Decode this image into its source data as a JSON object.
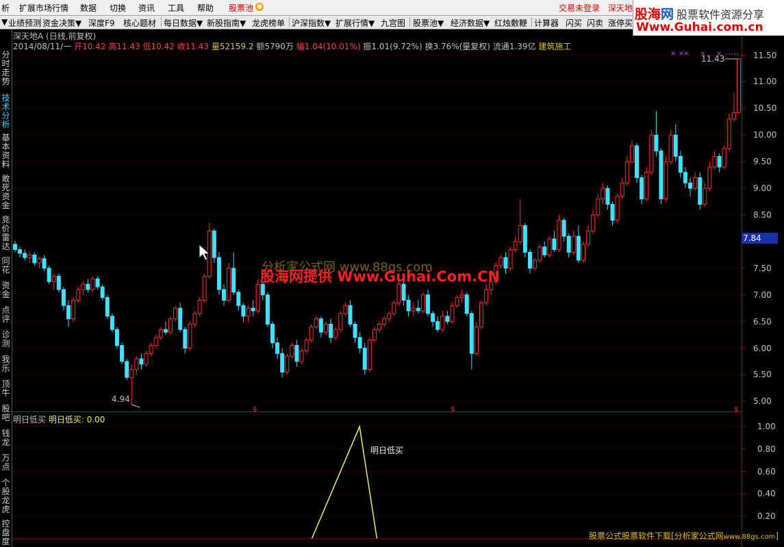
{
  "menu": {
    "items": [
      "析",
      "扩展市场行情",
      "数据",
      "切换",
      "资讯",
      "工具",
      "帮助"
    ],
    "stock_pool": "股票池",
    "login_status": "交易未登录",
    "market": "深天地"
  },
  "logo": {
    "brand_a": "股海",
    "brand_b": "网",
    "slogan": "股票软件资源分享",
    "url": "Www.Guhai.com.cn"
  },
  "toolbar": {
    "items": [
      "业绩预测",
      "资金决策▼",
      "深度F9",
      "核心题材",
      "每日数据▼",
      "新股指南▼",
      "龙虎榜单",
      "沪深指数▼",
      "扩展行情▼",
      "九宫图",
      "股票池▼",
      "经济数据▼",
      "红烛敷鞭",
      "计算器",
      "闪买",
      "闪卖",
      "涨停买"
    ]
  },
  "sidebar": {
    "items": [
      "分时走势",
      "技术分析",
      "基本资料",
      "敢死资金",
      "竞价雷达",
      "同花",
      "资金",
      "点评",
      "诊测",
      "我乐",
      "顶牛",
      "股吧",
      "钱龙",
      "万点",
      "个股龙虎",
      "控盘度"
    ],
    "active": "技术分析"
  },
  "chart_header": {
    "stock": "深天地A",
    "period": "(日线,前复权)"
  },
  "quote": {
    "date": "2014/08/11/一",
    "open_label": "开",
    "open": "10.42",
    "high_label": "高",
    "high": "11.43",
    "low_label": "低",
    "low": "10.42",
    "close_label": "收",
    "close": "11.43",
    "vol_label": "量",
    "volume": "52159.2",
    "amount_label": "额",
    "amount": "5790万",
    "chg_label": "幅",
    "change": "1.04(10.01%)",
    "amp_label": "振",
    "amplitude": "1.01(9.72%)",
    "turn_label": "换",
    "turnover": "3.76%(量复权)",
    "float_label": "流通",
    "float_cap": "1.39亿",
    "industry": "建筑施工"
  },
  "price_axis": {
    "ticks": [
      "11.50",
      "11.00",
      "10.50",
      "10.00",
      "9.50",
      "9.00",
      "8.50",
      "7.84",
      "7.50",
      "7.00",
      "6.50",
      "6.00",
      "5.50",
      "5.00"
    ],
    "current": "7.84"
  },
  "annotations": {
    "high_mark": "11.43",
    "low_mark": "4.94",
    "signal_marker": "$"
  },
  "indicator": {
    "name": "明日低买",
    "value_label": "明日低买: 0.00",
    "signal_text": "明日低买",
    "ticks": [
      "1.00",
      "0.80",
      "0.60",
      "0.40",
      "0.20"
    ]
  },
  "watermarks": {
    "line1": "分析家公式网 www.88gs.com",
    "line2": "股海网提供 Www.Guhai.Com.CN"
  },
  "footer": {
    "text": "股票公式股票软件下载[分析家公式网",
    "site": "www.88gs.com"
  },
  "colors": {
    "up": "#ff3030",
    "down": "#40e0ff",
    "grid": "#800000",
    "signal": "#f0f060"
  },
  "chart_data": {
    "type": "candlestick",
    "ylim": [
      4.85,
      11.7
    ],
    "candles": [
      [
        7.95,
        8.02,
        7.8,
        7.85
      ],
      [
        7.85,
        7.9,
        7.7,
        7.78
      ],
      [
        7.78,
        7.85,
        7.65,
        7.7
      ],
      [
        7.7,
        7.82,
        7.6,
        7.75
      ],
      [
        7.75,
        7.8,
        7.55,
        7.6
      ],
      [
        7.6,
        7.72,
        7.5,
        7.68
      ],
      [
        7.68,
        7.75,
        7.45,
        7.5
      ],
      [
        7.5,
        7.55,
        7.2,
        7.25
      ],
      [
        7.25,
        7.4,
        7.1,
        7.35
      ],
      [
        7.35,
        7.4,
        7.05,
        7.1
      ],
      [
        7.1,
        7.15,
        6.7,
        6.8
      ],
      [
        6.8,
        6.9,
        6.4,
        6.55
      ],
      [
        6.55,
        6.95,
        6.5,
        6.9
      ],
      [
        6.9,
        7.15,
        6.85,
        7.1
      ],
      [
        7.1,
        7.25,
        7.0,
        7.2
      ],
      [
        7.2,
        7.3,
        7.05,
        7.1
      ],
      [
        7.1,
        7.35,
        7.05,
        7.3
      ],
      [
        7.3,
        7.35,
        7.1,
        7.15
      ],
      [
        7.15,
        7.2,
        6.9,
        6.95
      ],
      [
        6.95,
        7.0,
        6.55,
        6.6
      ],
      [
        6.6,
        6.65,
        6.3,
        6.35
      ],
      [
        6.35,
        6.4,
        6.0,
        6.05
      ],
      [
        6.05,
        6.1,
        5.7,
        5.75
      ],
      [
        5.75,
        5.8,
        5.4,
        5.45
      ],
      [
        5.45,
        5.7,
        4.94,
        5.6
      ],
      [
        5.6,
        5.85,
        5.5,
        5.8
      ],
      [
        5.8,
        5.9,
        5.6,
        5.7
      ],
      [
        5.7,
        5.95,
        5.65,
        5.9
      ],
      [
        5.9,
        6.1,
        5.85,
        6.05
      ],
      [
        6.05,
        6.25,
        6.0,
        6.2
      ],
      [
        6.2,
        6.4,
        6.15,
        6.35
      ],
      [
        6.35,
        6.5,
        6.25,
        6.3
      ],
      [
        6.3,
        6.6,
        6.25,
        6.55
      ],
      [
        6.55,
        6.8,
        6.5,
        6.75
      ],
      [
        6.75,
        6.85,
        6.3,
        6.35
      ],
      [
        6.35,
        6.4,
        5.9,
        6.0
      ],
      [
        6.0,
        6.5,
        5.95,
        6.45
      ],
      [
        6.45,
        6.7,
        6.4,
        6.65
      ],
      [
        6.65,
        6.95,
        6.6,
        6.9
      ],
      [
        6.9,
        7.4,
        6.85,
        7.35
      ],
      [
        7.35,
        8.35,
        7.3,
        8.2
      ],
      [
        8.2,
        8.25,
        7.6,
        7.7
      ],
      [
        7.7,
        7.8,
        7.0,
        7.1
      ],
      [
        7.1,
        7.2,
        6.8,
        6.9
      ],
      [
        6.9,
        7.6,
        6.85,
        7.5
      ],
      [
        7.5,
        7.8,
        7.0,
        7.05
      ],
      [
        7.05,
        7.1,
        6.7,
        6.8
      ],
      [
        6.8,
        6.85,
        6.5,
        6.6
      ],
      [
        6.6,
        6.8,
        6.5,
        6.75
      ],
      [
        6.75,
        6.9,
        6.6,
        6.7
      ],
      [
        6.7,
        7.3,
        6.65,
        7.2
      ],
      [
        7.2,
        7.25,
        6.9,
        7.0
      ],
      [
        7.0,
        7.05,
        6.4,
        6.45
      ],
      [
        6.45,
        6.5,
        6.0,
        6.1
      ],
      [
        6.1,
        6.2,
        5.8,
        5.9
      ],
      [
        5.9,
        6.0,
        5.45,
        5.55
      ],
      [
        5.55,
        5.9,
        5.5,
        5.85
      ],
      [
        5.85,
        6.1,
        5.8,
        6.05
      ],
      [
        6.05,
        6.15,
        5.65,
        5.75
      ],
      [
        5.75,
        6.0,
        5.7,
        5.95
      ],
      [
        5.95,
        6.2,
        5.9,
        6.15
      ],
      [
        6.15,
        6.45,
        6.1,
        6.4
      ],
      [
        6.4,
        6.6,
        6.35,
        6.55
      ],
      [
        6.55,
        6.6,
        6.2,
        6.3
      ],
      [
        6.3,
        6.5,
        6.25,
        6.45
      ],
      [
        6.45,
        6.55,
        6.1,
        6.2
      ],
      [
        6.2,
        6.4,
        6.15,
        6.35
      ],
      [
        6.35,
        6.7,
        6.3,
        6.65
      ],
      [
        6.65,
        6.85,
        6.6,
        6.8
      ],
      [
        6.8,
        6.9,
        6.4,
        6.45
      ],
      [
        6.45,
        6.5,
        6.1,
        6.2
      ],
      [
        6.2,
        6.3,
        5.9,
        6.0
      ],
      [
        6.0,
        6.1,
        5.5,
        5.6
      ],
      [
        5.6,
        6.2,
        5.55,
        6.15
      ],
      [
        6.15,
        6.4,
        6.1,
        6.35
      ],
      [
        6.35,
        6.5,
        6.3,
        6.45
      ],
      [
        6.45,
        6.6,
        6.4,
        6.55
      ],
      [
        6.55,
        6.7,
        6.5,
        6.65
      ],
      [
        6.65,
        6.9,
        6.6,
        6.85
      ],
      [
        6.85,
        7.3,
        6.8,
        7.2
      ],
      [
        7.2,
        7.25,
        6.8,
        6.9
      ],
      [
        6.9,
        7.0,
        6.6,
        6.7
      ],
      [
        6.7,
        6.85,
        6.6,
        6.75
      ],
      [
        6.75,
        6.9,
        6.65,
        6.7
      ],
      [
        6.7,
        7.05,
        6.65,
        7.0
      ],
      [
        7.0,
        7.1,
        6.6,
        6.65
      ],
      [
        6.65,
        6.7,
        6.4,
        6.5
      ],
      [
        6.5,
        6.6,
        6.3,
        6.35
      ],
      [
        6.35,
        6.7,
        6.3,
        6.6
      ],
      [
        6.6,
        6.7,
        6.45,
        6.5
      ],
      [
        6.5,
        6.85,
        6.45,
        6.8
      ],
      [
        6.8,
        7.0,
        6.75,
        6.95
      ],
      [
        6.95,
        7.1,
        6.85,
        7.0
      ],
      [
        7.0,
        7.05,
        6.6,
        6.65
      ],
      [
        6.65,
        6.7,
        5.6,
        5.9
      ],
      [
        5.9,
        6.5,
        5.85,
        6.4
      ],
      [
        6.4,
        6.9,
        6.35,
        6.85
      ],
      [
        6.85,
        7.2,
        6.8,
        7.1
      ],
      [
        7.1,
        7.3,
        7.0,
        7.25
      ],
      [
        7.25,
        7.6,
        7.2,
        7.55
      ],
      [
        7.55,
        7.75,
        7.5,
        7.7
      ],
      [
        7.7,
        7.8,
        7.4,
        7.5
      ],
      [
        7.5,
        7.9,
        7.45,
        7.85
      ],
      [
        7.85,
        8.1,
        7.8,
        8.0
      ],
      [
        8.0,
        8.8,
        7.95,
        8.3
      ],
      [
        8.3,
        8.35,
        7.7,
        7.8
      ],
      [
        7.8,
        7.85,
        7.4,
        7.5
      ],
      [
        7.5,
        7.7,
        7.45,
        7.65
      ],
      [
        7.65,
        7.95,
        7.6,
        7.9
      ],
      [
        7.9,
        8.0,
        7.7,
        7.75
      ],
      [
        7.75,
        8.1,
        7.7,
        8.05
      ],
      [
        8.05,
        8.2,
        7.8,
        7.85
      ],
      [
        7.85,
        8.5,
        7.8,
        8.4
      ],
      [
        8.4,
        8.45,
        8.0,
        8.1
      ],
      [
        8.1,
        8.15,
        7.7,
        7.8
      ],
      [
        7.8,
        8.2,
        7.75,
        8.1
      ],
      [
        8.1,
        8.3,
        7.6,
        7.65
      ],
      [
        7.65,
        8.0,
        7.6,
        7.95
      ],
      [
        7.95,
        8.3,
        7.9,
        8.2
      ],
      [
        8.2,
        8.6,
        8.15,
        8.5
      ],
      [
        8.5,
        8.9,
        8.45,
        8.8
      ],
      [
        8.8,
        9.1,
        8.7,
        9.0
      ],
      [
        9.0,
        9.05,
        8.6,
        8.7
      ],
      [
        8.7,
        8.75,
        8.3,
        8.4
      ],
      [
        8.4,
        8.9,
        8.35,
        8.85
      ],
      [
        8.85,
        9.2,
        8.8,
        9.1
      ],
      [
        9.1,
        9.6,
        9.05,
        9.5
      ],
      [
        9.5,
        9.9,
        9.45,
        9.8
      ],
      [
        9.8,
        9.85,
        9.1,
        9.2
      ],
      [
        9.2,
        9.25,
        8.7,
        8.8
      ],
      [
        8.8,
        9.4,
        8.75,
        9.3
      ],
      [
        9.3,
        10.1,
        9.25,
        10.0
      ],
      [
        10.0,
        10.45,
        9.6,
        9.7
      ],
      [
        9.7,
        9.75,
        8.7,
        8.8
      ],
      [
        8.8,
        9.6,
        8.75,
        9.5
      ],
      [
        9.5,
        10.1,
        9.45,
        10.0
      ],
      [
        10.0,
        10.2,
        9.5,
        9.6
      ],
      [
        9.6,
        9.7,
        9.2,
        9.3
      ],
      [
        9.3,
        9.4,
        9.0,
        9.1
      ],
      [
        9.1,
        9.2,
        8.85,
        9.0
      ],
      [
        9.0,
        9.3,
        8.95,
        9.2
      ],
      [
        9.2,
        9.3,
        8.6,
        8.7
      ],
      [
        8.7,
        9.1,
        8.65,
        9.0
      ],
      [
        9.0,
        9.5,
        8.95,
        9.4
      ],
      [
        9.4,
        9.7,
        9.35,
        9.6
      ],
      [
        9.6,
        9.65,
        9.3,
        9.4
      ],
      [
        9.4,
        9.8,
        9.35,
        9.75
      ],
      [
        9.75,
        10.4,
        9.7,
        10.3
      ],
      [
        10.3,
        10.8,
        10.25,
        10.42
      ],
      [
        10.42,
        11.43,
        10.42,
        11.43
      ]
    ],
    "indicator_values": [
      [
        0.41,
        0
      ],
      [
        0.476,
        1
      ],
      [
        0.5,
        0
      ]
    ]
  }
}
